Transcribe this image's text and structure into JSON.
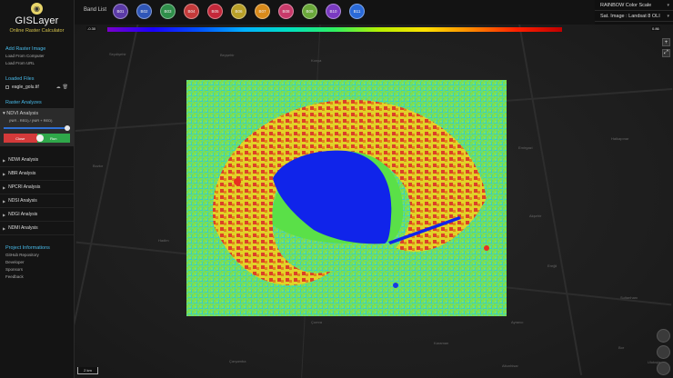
{
  "app": {
    "title": "GISLayer",
    "subtitle": "Online Raster Calculator"
  },
  "sidebar": {
    "add_raster": {
      "heading": "Add Raster Image",
      "links": [
        "Load From Computer",
        "Load From URL"
      ]
    },
    "loaded_files": {
      "heading": "Loaded Files",
      "files": [
        {
          "name": "eagle_golu.tif"
        }
      ]
    },
    "raster_analyzes": {
      "heading": "Raster Analyzes",
      "active": {
        "label": "NDVI Analysis",
        "formula": "(NIR - RED) / (NIR + RED)",
        "close_label": "Close",
        "run_label": "Run",
        "slider_value": 1.0
      },
      "items": [
        {
          "label": "NDWI Analysis"
        },
        {
          "label": "NBR Analysis"
        },
        {
          "label": "NPCRI Analysis"
        },
        {
          "label": "NDSI Analysis"
        },
        {
          "label": "NDGI Analysis"
        },
        {
          "label": "NDMI Analysis"
        }
      ]
    },
    "project": {
      "heading": "Project Informations",
      "links": [
        "GitHub Repository",
        "Developer",
        "Sponsors",
        "Feedback"
      ]
    }
  },
  "topbar": {
    "band_list_label": "Band List",
    "bands": [
      {
        "label": "B01",
        "color": "#5b3aa6"
      },
      {
        "label": "B02",
        "color": "#2f56b8"
      },
      {
        "label": "B03",
        "color": "#2f8f4a"
      },
      {
        "label": "B04",
        "color": "#c43a3a"
      },
      {
        "label": "B05",
        "color": "#c4283a"
      },
      {
        "label": "B06",
        "color": "#b8a028"
      },
      {
        "label": "B07",
        "color": "#d88a1a"
      },
      {
        "label": "B08",
        "color": "#c83a6a"
      },
      {
        "label": "B09",
        "color": "#6aa83a"
      },
      {
        "label": "B10",
        "color": "#7a3ac0"
      },
      {
        "label": "B11",
        "color": "#2a6ad8"
      }
    ]
  },
  "colorbar": {
    "min_label": "-0.30",
    "max_label": "0.86"
  },
  "right_panel": {
    "color_scale": "RAINBOW Color Scale",
    "sat_image": "Sat. Image : Landsat 8 OLI"
  },
  "map": {
    "places": [
      {
        "name": "Seydişehir"
      },
      {
        "name": "Beyşehir"
      },
      {
        "name": "Konya"
      },
      {
        "name": "Bozkır"
      },
      {
        "name": "Çumra"
      },
      {
        "name": "Karaman"
      },
      {
        "name": "Ereğli"
      },
      {
        "name": "Akşehir"
      },
      {
        "name": "Hadim"
      },
      {
        "name": "Ayrancı"
      },
      {
        "name": "Sultanhanı"
      },
      {
        "name": "Emirgazi"
      },
      {
        "name": "Çarşamba"
      },
      {
        "name": "Altunhisar"
      },
      {
        "name": "Bor"
      },
      {
        "name": "Ulukışla"
      },
      {
        "name": "Halkapınar"
      }
    ],
    "scale_label": "2 km"
  }
}
